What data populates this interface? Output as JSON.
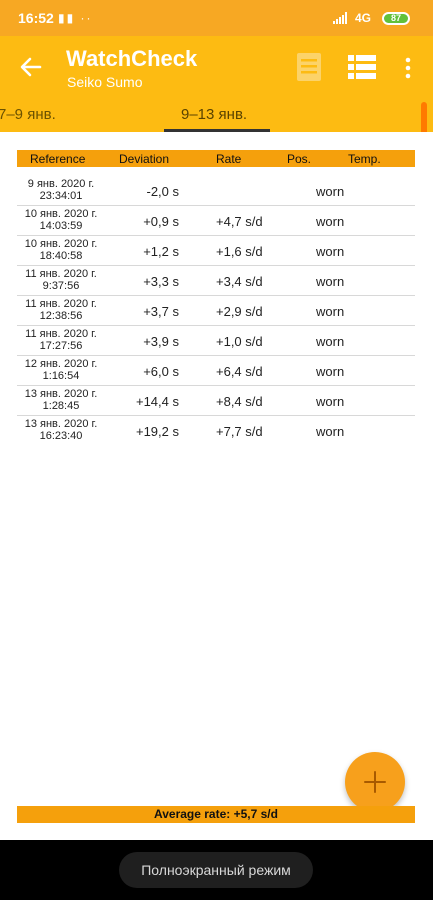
{
  "status_bar": {
    "time": "16:52",
    "left_icons": "▮▮ ··",
    "network": "4G",
    "battery": "87",
    "battery_color": "#62c13b"
  },
  "app_bar": {
    "title": "WatchCheck",
    "subtitle": "Seiko Sumo",
    "back_icon": "arrow-left-icon",
    "actions": [
      "document-icon",
      "list-icon",
      "more-vert-icon"
    ]
  },
  "tabs": [
    {
      "label": "7–9 янв."
    },
    {
      "label": "9–13 янв.",
      "selected": true
    }
  ],
  "table": {
    "headers": {
      "reference": "Reference",
      "deviation": "Deviation",
      "rate": "Rate",
      "pos": "Pos.",
      "temp": "Temp."
    },
    "rows": [
      {
        "date": "9 янв. 2020 г.",
        "time": "23:34:01",
        "deviation": "-2,0 s",
        "rate": "",
        "pos": "worn"
      },
      {
        "date": "10 янв. 2020 г.",
        "time": "14:03:59",
        "deviation": "+0,9 s",
        "rate": "+4,7 s/d",
        "pos": "worn"
      },
      {
        "date": "10 янв. 2020 г.",
        "time": "18:40:58",
        "deviation": "+1,2 s",
        "rate": "+1,6 s/d",
        "pos": "worn"
      },
      {
        "date": "11 янв. 2020 г.",
        "time": "9:37:56",
        "deviation": "+3,3 s",
        "rate": "+3,4 s/d",
        "pos": "worn"
      },
      {
        "date": "11 янв. 2020 г.",
        "time": "12:38:56",
        "deviation": "+3,7 s",
        "rate": "+2,9 s/d",
        "pos": "worn"
      },
      {
        "date": "11 янв. 2020 г.",
        "time": "17:27:56",
        "deviation": "+3,9 s",
        "rate": "+1,0 s/d",
        "pos": "worn"
      },
      {
        "date": "12 янв. 2020 г.",
        "time": "1:16:54",
        "deviation": "+6,0 s",
        "rate": "+6,4 s/d",
        "pos": "worn"
      },
      {
        "date": "13 янв. 2020 г.",
        "time": "1:28:45",
        "deviation": "+14,4 s",
        "rate": "+8,4 s/d",
        "pos": "worn"
      },
      {
        "date": "13 янв. 2020 г.",
        "time": "16:23:40",
        "deviation": "+19,2 s",
        "rate": "+7,7 s/d",
        "pos": "worn"
      }
    ]
  },
  "footer": {
    "average_rate": "Average rate: +5,7 s/d"
  },
  "fab": {
    "icon": "plus-icon"
  },
  "nav_bar": {
    "fullscreen_label": "Полноэкранный режим"
  },
  "colors": {
    "accent": "#fdbb12",
    "header_orange": "#f5a00c",
    "status_bar": "#f7a823"
  }
}
